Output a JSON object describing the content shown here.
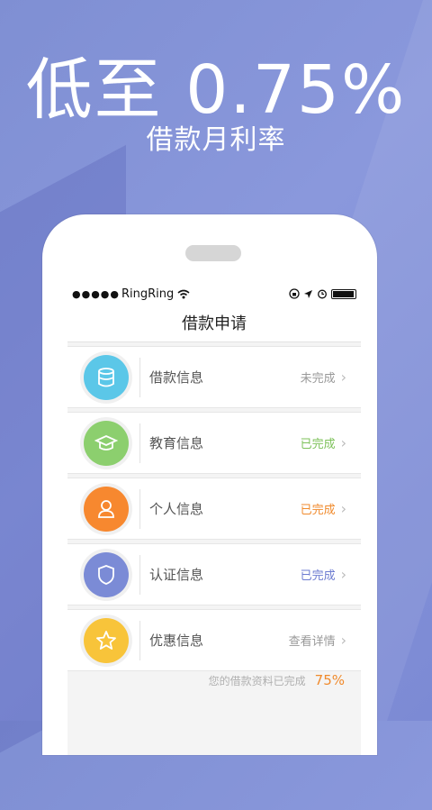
{
  "promo": {
    "headline": "低至 0.75%",
    "subline": "借款月利率"
  },
  "status_bar": {
    "signal": "●●●●●",
    "carrier": "RingRing",
    "wifi_icon": "wifi-icon"
  },
  "nav": {
    "title": "借款申请"
  },
  "items": [
    {
      "label": "借款信息",
      "status": "未完成",
      "icon": "database-icon",
      "color": "#5bc7e8",
      "status_color": "#999999"
    },
    {
      "label": "教育信息",
      "status": "已完成",
      "icon": "graduation-cap-icon",
      "color": "#8ccf6e",
      "status_color": "#7dc15a"
    },
    {
      "label": "个人信息",
      "status": "已完成",
      "icon": "person-icon",
      "color": "#f7882f",
      "status_color": "#f08a2c"
    },
    {
      "label": "认证信息",
      "status": "已完成",
      "icon": "shield-icon",
      "color": "#7b8bd6",
      "status_color": "#6c7bd0"
    },
    {
      "label": "优惠信息",
      "status": "查看详情",
      "icon": "star-icon",
      "color": "#f8c43a",
      "status_color": "#999999"
    }
  ],
  "footer": {
    "text": "您的借款资料已完成",
    "percent": "75%"
  }
}
